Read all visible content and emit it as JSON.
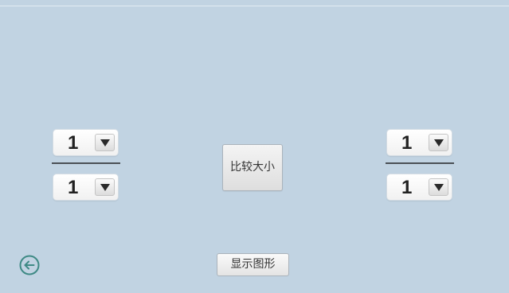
{
  "left_fraction": {
    "numerator": "1",
    "denominator": "1"
  },
  "right_fraction": {
    "numerator": "1",
    "denominator": "1"
  },
  "compare_button": {
    "label": "比较大小"
  },
  "show_button": {
    "label": "显示图形"
  },
  "icons": {
    "back": "back-arrow-circle-icon",
    "dropdown": "caret-down-icon"
  },
  "colors": {
    "background": "#c1d3e2",
    "fraction_bar": "#4a4f55",
    "back_icon": "#3f8a85"
  }
}
